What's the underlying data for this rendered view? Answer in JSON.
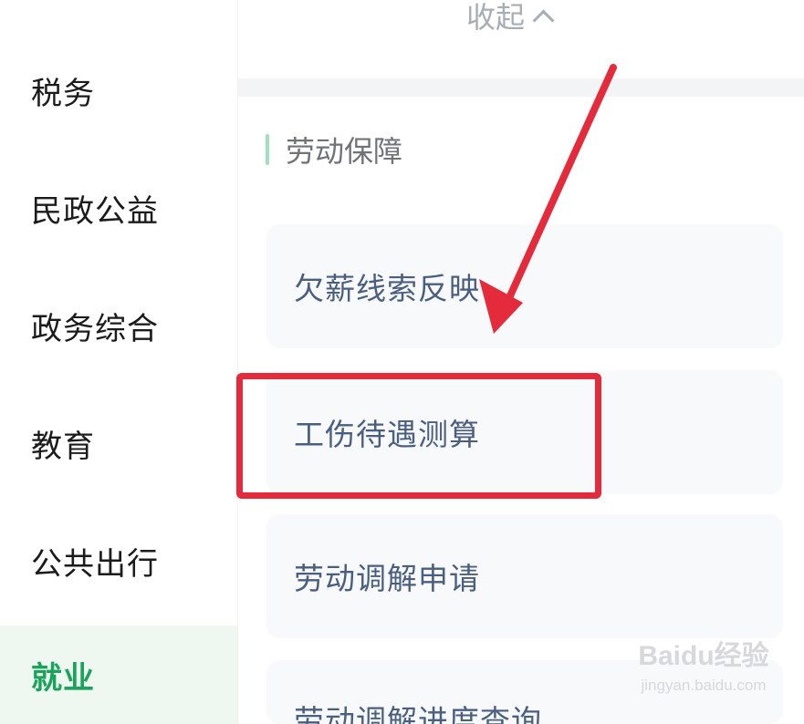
{
  "sidebar": {
    "items": [
      {
        "label": "税务"
      },
      {
        "label": "民政公益"
      },
      {
        "label": "政务综合"
      },
      {
        "label": "教育"
      },
      {
        "label": "公共出行"
      },
      {
        "label": "就业",
        "active": true
      }
    ]
  },
  "main": {
    "collapse_label": "收起",
    "section_title": "劳动保障",
    "cards": [
      {
        "label": "欠薪线索反映"
      },
      {
        "label": "工伤待遇测算",
        "highlighted": true
      },
      {
        "label": "劳动调解申请"
      },
      {
        "label": "劳动调解进度查询"
      }
    ]
  },
  "watermark": {
    "text": "Baidu经验",
    "sub": "jingyan.baidu.com"
  },
  "colors": {
    "accent": "#1aa35a",
    "annotation_red": "#e32b3b",
    "card_text": "#4a5e80"
  }
}
